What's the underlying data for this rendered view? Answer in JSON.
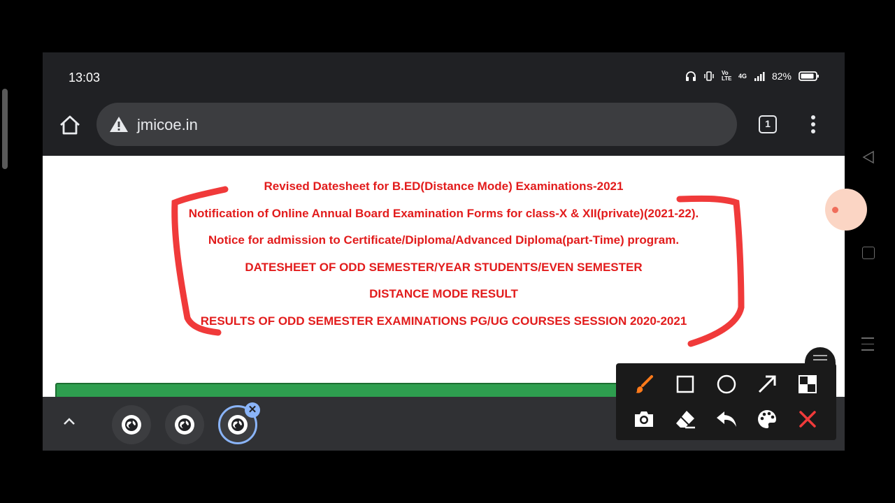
{
  "status": {
    "time": "13:03",
    "battery": "82%",
    "network": "4G",
    "volte": "Vo LTE"
  },
  "browser": {
    "url": "jmicoe.in",
    "tab_count": "1"
  },
  "notices": [
    "Revised Datesheet for B.ED(Distance Mode) Examinations-2021",
    "Notification of Online Annual Board Examination Forms for class-X & XII(private)(2021-22).",
    "Notice for admission to Certificate/Diploma/Advanced Diploma(part-Time) program.",
    "DATESHEET OF ODD SEMESTER/YEAR STUDENTS/EVEN SEMESTER",
    "DISTANCE MODE RESULT",
    "RESULTS OF ODD SEMESTER EXAMINATIONS PG/UG COURSES SESSION 2020-2021"
  ],
  "colors": {
    "notice_text": "#e21c1c",
    "annotation": "#f03a3a",
    "green_bar": "#2e9e4f",
    "accent": "#8ab4f8",
    "brush": "#ff7a1a"
  },
  "draw_tools": {
    "row1": [
      "brush-icon",
      "square-icon",
      "circle-icon",
      "arrow-icon",
      "mosaic-icon"
    ],
    "row2": [
      "camera-icon",
      "eraser-icon",
      "undo-icon",
      "palette-icon",
      "close-icon"
    ]
  }
}
